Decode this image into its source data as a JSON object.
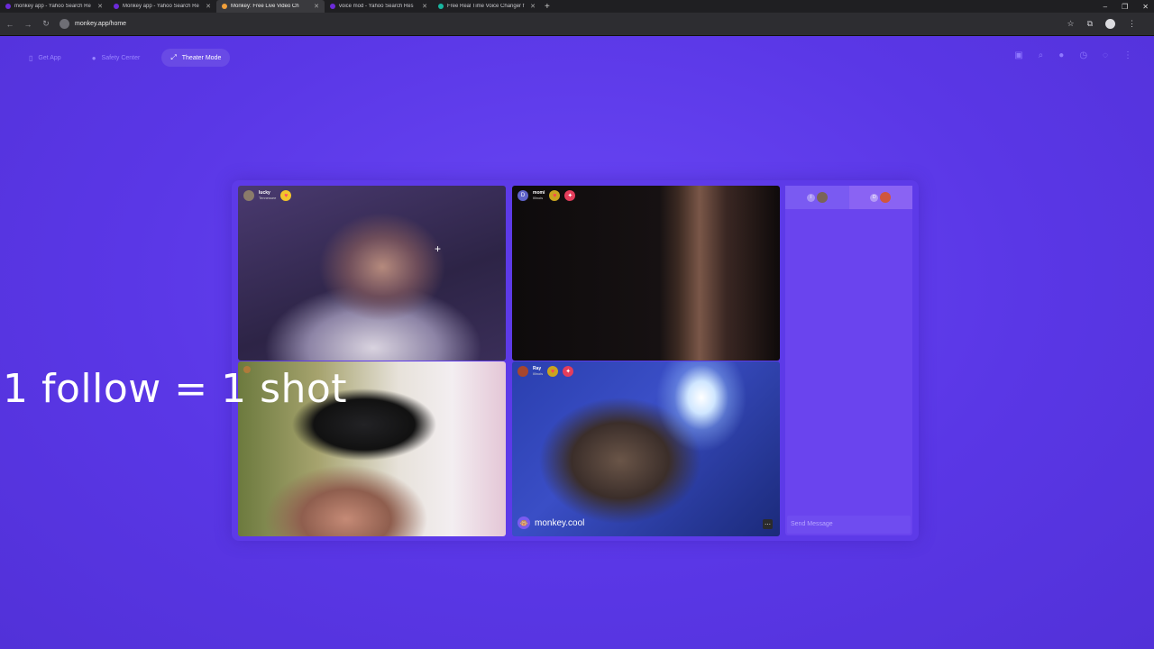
{
  "browser": {
    "tabs": [
      {
        "title": "monkey app - Yahoo Search Re",
        "favicon_color": "#6c2bd9",
        "active": false
      },
      {
        "title": "Monkey app - Yahoo Search Re",
        "favicon_color": "#6c2bd9",
        "active": false
      },
      {
        "title": "Monkey: Free Live Video Ch",
        "favicon_color": "#f2a03a",
        "active": true
      },
      {
        "title": "voice mod - Yahoo Search Res",
        "favicon_color": "#6c2bd9",
        "active": false
      },
      {
        "title": "Free Real Time Voice Changer f",
        "favicon_color": "#18b6a0",
        "active": false
      }
    ],
    "url": "monkey.app/home"
  },
  "topnav": {
    "get_app": "Get App",
    "safety_center": "Safety Center",
    "theater_mode": "Theater Mode"
  },
  "overlay_text": "1 follow = 1 shot",
  "tiles": [
    {
      "name": "lucky",
      "location": "Tennessee",
      "badges": [
        "heart-yellow"
      ]
    },
    {
      "name": "momi",
      "location": "Illinois",
      "initial": "D",
      "badges": [
        "heart-olive",
        "heart-red"
      ]
    },
    {
      "name": "",
      "location": "",
      "badges": []
    },
    {
      "name": "Ray",
      "location": "Illinois",
      "badges": [
        "heart-olive",
        "heart-red"
      ]
    }
  ],
  "watermark": "monkey.cool",
  "chat": {
    "user_a_initial": "I",
    "user_b_initial": "D",
    "placeholder": "Send Message"
  },
  "colors": {
    "page_bg": "#5a37e6",
    "panel_bg": "#6a44ee",
    "accent_text": "#9a86ff"
  }
}
